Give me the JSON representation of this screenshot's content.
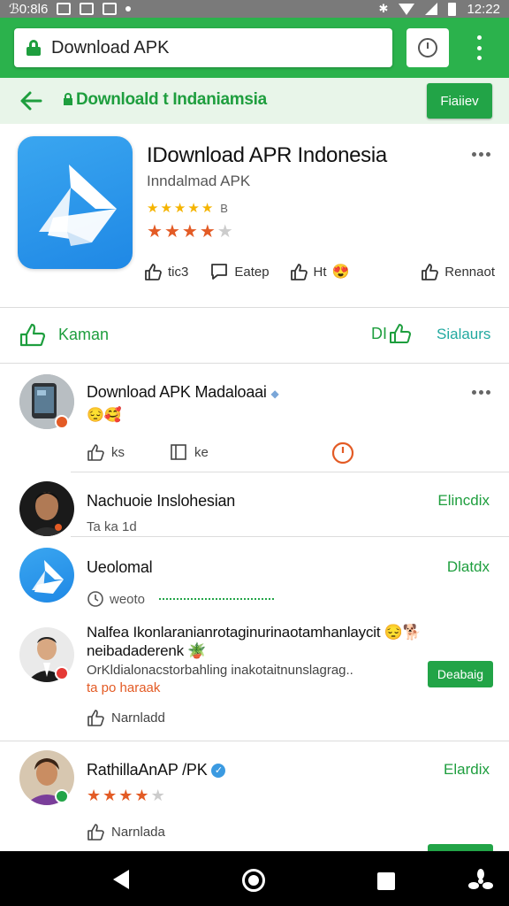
{
  "status_bar": {
    "left_text": "ℬ0:8l6",
    "time": "12:22"
  },
  "browser": {
    "url": "Download APK"
  },
  "header": {
    "title": "Downloald t Indaniamsia",
    "button": "Fiaiiev"
  },
  "app": {
    "title": "IDownload APR Indonesia",
    "subtitle": "Inndalmad APK",
    "rating_top_count": "B",
    "actions": [
      "tic3",
      "Eatep",
      "Ht",
      "Rennaot"
    ]
  },
  "tabs": {
    "left": "Kaman",
    "mid": "DI",
    "right": "Sialaurs"
  },
  "feed": [
    {
      "title": "Download APK Madaloaai",
      "emoji": "😔🥰",
      "actions": [
        "ks",
        "ke"
      ]
    },
    {
      "title": "Nachuoie Inslohesian",
      "meta": "Ta ka 1d",
      "link": "Elincdix"
    },
    {
      "title": "Ueolomal",
      "meta": "weoto",
      "link": "Dlatdx"
    },
    {
      "title_line1": "Nalfea Ikonlaranianrotaginurinaotamhanlaycit 😔🐕",
      "title_line2": "neibadaderenk 🪴",
      "desc": "OrKldialonacstorbahling inakotaitnunslagrag..",
      "highlight": "ta po haraak",
      "button": "Deabaig",
      "action": "Narnladd"
    },
    {
      "title": "RathillaAnAP /PK",
      "link": "Elardix",
      "action": "Narnlada"
    }
  ],
  "colors": {
    "brand_green": "#22a447",
    "header_bg": "#e8f5e9",
    "star_gold": "#f5b400",
    "star_orange": "#e35b25",
    "teal": "#22a9a0"
  }
}
